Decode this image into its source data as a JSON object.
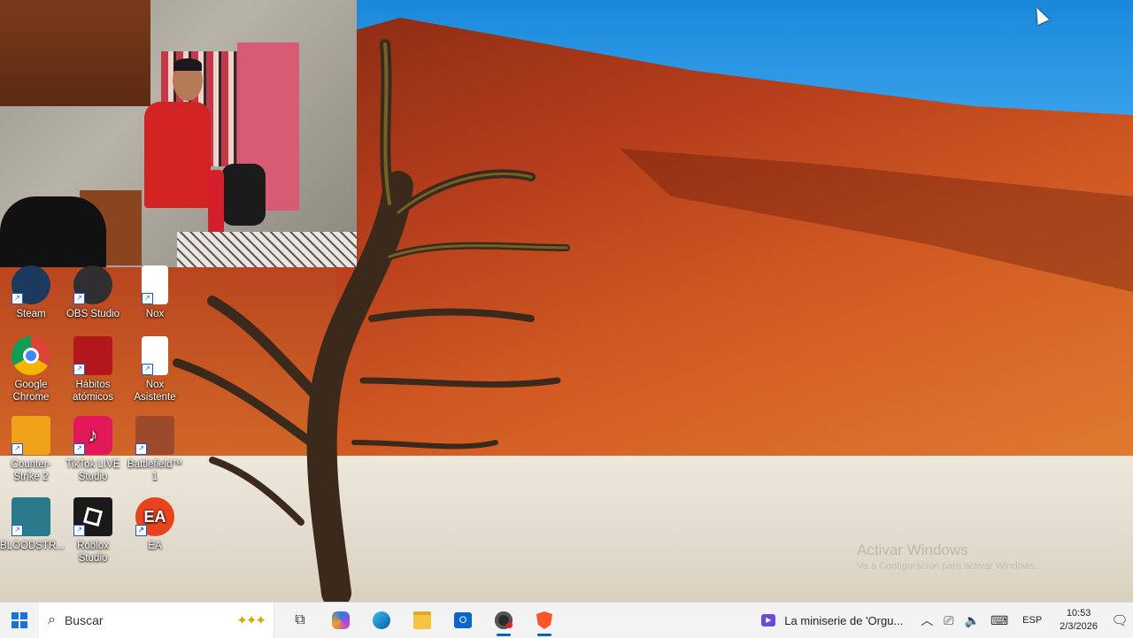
{
  "desktop": {
    "icons": [
      {
        "label": "Steam",
        "icon": "steam-icon",
        "color": "#1b3a5e"
      },
      {
        "label": "OBS Studio",
        "icon": "obs-icon",
        "color": "#302e31"
      },
      {
        "label": "Nox",
        "icon": "file-icon",
        "color": "#ffffff"
      },
      {
        "label": "Google Chrome",
        "icon": "chrome-icon",
        "color": "#4285f4"
      },
      {
        "label": "Hábitos atómicos",
        "icon": "habits-icon",
        "color": "#b3161b"
      },
      {
        "label": "Nox Asistente",
        "icon": "file-icon",
        "color": "#ffffff"
      },
      {
        "label": "Counter-Strike 2",
        "icon": "counter-strike-icon",
        "color": "#f0a21b"
      },
      {
        "label": "TikTok LIVE Studio",
        "icon": "tiktok-icon",
        "color": "#e2185b"
      },
      {
        "label": "Battlefield™ 1",
        "icon": "battlefield-icon",
        "color": "#9c4a2b"
      },
      {
        "label": "BLOODSTR...",
        "icon": "bloodstrike-icon",
        "color": "#2a7a8c"
      },
      {
        "label": "Roblox Studio",
        "icon": "roblox-icon",
        "color": "#1a1a1a"
      },
      {
        "label": "EA",
        "icon": "ea-icon",
        "color": "#e8431c"
      }
    ],
    "watermark_title": "Activar Windows",
    "watermark_sub": "Ve a Configuración para activar Windows."
  },
  "taskbar": {
    "search_placeholder": "Buscar",
    "apps": [
      {
        "name": "task-view",
        "icon": "task-view-icon",
        "glyph": "⧉"
      },
      {
        "name": "copilot",
        "icon": "copilot-icon",
        "glyph": "✦"
      },
      {
        "name": "edge",
        "icon": "edge-icon",
        "glyph": "e"
      },
      {
        "name": "file-explorer",
        "icon": "folder-icon",
        "glyph": "▬"
      },
      {
        "name": "outlook",
        "icon": "outlook-icon",
        "glyph": "O"
      },
      {
        "name": "obs",
        "icon": "obs-icon",
        "glyph": "●"
      },
      {
        "name": "brave",
        "icon": "brave-icon",
        "glyph": "◆"
      }
    ],
    "media_title": "La miniserie de 'Orgu...",
    "language": "ESP",
    "time": "10:53",
    "date": "2/3/2026"
  }
}
